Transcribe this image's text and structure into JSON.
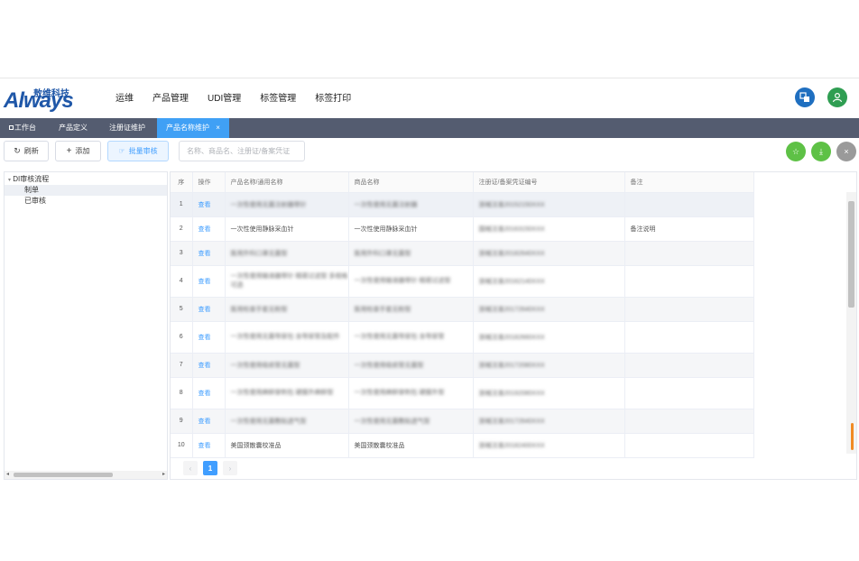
{
  "brand": {
    "logo_text": "Always",
    "logo_chinese": "敖维科技"
  },
  "nav": {
    "items": [
      "运维",
      "产品管理",
      "UDI管理",
      "标签管理",
      "标签打印"
    ]
  },
  "tabs": [
    {
      "label": "工作台",
      "icon": "home-icon"
    },
    {
      "label": "产品定义"
    },
    {
      "label": "注册证维护"
    },
    {
      "label": "产品名称维护",
      "close": "×"
    }
  ],
  "toolbar": {
    "refresh_label": "刷新",
    "add_label": "添加",
    "batch_review_label": "批量审核",
    "search_placeholder": "名称、商品名、注册证/备案凭证"
  },
  "tree": {
    "root": "DI审核流程",
    "children": [
      "制单",
      "已审核"
    ],
    "selected": "制单"
  },
  "table": {
    "headers": [
      "序",
      "操作",
      "产品名称/通用名称",
      "商品名称",
      "注册证/备案凭证编号",
      "备注"
    ],
    "action_label": "查看",
    "rows": [
      {
        "no": "1",
        "name": "一次性使用无菌注射器带针",
        "trade": "一次性使用无菌注射器",
        "reg": "浙械注准20152150XXX",
        "note": ""
      },
      {
        "no": "2",
        "name": "一次性使用静脉采血针",
        "trade": "一次性使用静脉采血针",
        "reg": "国械注准20163150XXX",
        "note": "备注说明"
      },
      {
        "no": "3",
        "name": "医用外科口罩无菌型",
        "trade": "医用外科口罩无菌型",
        "reg": "浙械注准20182640XXX",
        "note": ""
      },
      {
        "no": "4",
        "name": "一次性使用输液器带针 精密过滤型 多规格可选",
        "trade": "一次性使用输液器带针 精密过滤型",
        "reg": "浙械注准20162140XXX",
        "note": ""
      },
      {
        "no": "5",
        "name": "医用检查手套无粉型",
        "trade": "医用检查手套无粉型",
        "reg": "浙械注准20172640XXX",
        "note": ""
      },
      {
        "no": "6",
        "name": "一次性使用无菌导尿包 含导尿管及配件",
        "trade": "一次性使用无菌导尿包 含导尿管",
        "reg": "浙械注准20182660XXX",
        "note": ""
      },
      {
        "no": "7",
        "name": "一次性使用吸痰管无菌型",
        "trade": "一次性使用吸痰管无菌型",
        "reg": "浙械注准20172080XXX",
        "note": ""
      },
      {
        "no": "8",
        "name": "一次性使用麻醉穿刺包 硬膜外麻醉型",
        "trade": "一次性使用麻醉穿刺包 硬膜外型",
        "reg": "浙械注准20192080XXX",
        "note": ""
      },
      {
        "no": "9",
        "name": "一次性使用无菌敷贴透气型",
        "trade": "一次性使用无菌敷贴透气型",
        "reg": "浙械注准20172640XXX",
        "note": ""
      },
      {
        "no": "10",
        "name": "美国颈散囊校准品",
        "trade": "美国颈散囊校准品",
        "reg": "浙械注准20182400XXX",
        "note": ""
      }
    ]
  },
  "pagination": {
    "current": "1",
    "prev": "‹",
    "next": "›"
  },
  "colors": {
    "accent": "#409eff",
    "tabbar": "#545c70",
    "active_tab": "#40a0f5",
    "green": "#5ec146",
    "gray": "#9a9a9a",
    "brand": "#1f57a8"
  }
}
